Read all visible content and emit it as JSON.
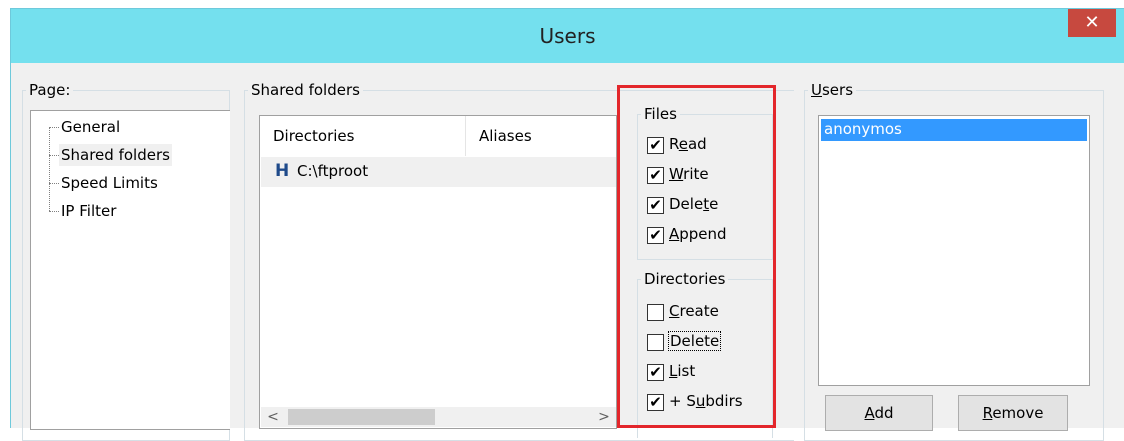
{
  "window": {
    "title": "Users",
    "close_glyph": "✕"
  },
  "page_panel": {
    "label": "Page:",
    "items": [
      "General",
      "Shared folders",
      "Speed Limits",
      "IP Filter"
    ],
    "selected": "Shared folders"
  },
  "shared_folders": {
    "label": "Shared folders",
    "columns": [
      "Directories",
      "Aliases"
    ],
    "rows": [
      {
        "marker": "H",
        "directory": "C:\\ftproot",
        "alias": ""
      }
    ],
    "scroll_left": "<",
    "scroll_right": ">"
  },
  "files": {
    "label": "Files",
    "read": {
      "pre": "R",
      "u": "e",
      "post": "ad",
      "checked": true
    },
    "write": {
      "pre": "",
      "u": "W",
      "post": "rite",
      "checked": true
    },
    "delete": {
      "pre": "Dele",
      "u": "t",
      "post": "e",
      "checked": true
    },
    "append": {
      "pre": "",
      "u": "A",
      "post": "ppend",
      "checked": true
    }
  },
  "directories": {
    "label": "Directories",
    "create": {
      "pre": "",
      "u": "C",
      "post": "reate",
      "checked": false
    },
    "delete": {
      "text": "Delete",
      "checked": false
    },
    "list": {
      "pre": "",
      "u": "L",
      "post": "ist",
      "checked": true
    },
    "subdirs": {
      "pre": "+ S",
      "u": "u",
      "post": "bdirs",
      "checked": true
    }
  },
  "users_panel": {
    "label_u": "U",
    "label_rest": "sers",
    "items": [
      "anonymos"
    ],
    "add_u": "A",
    "add_rest": "dd",
    "remove_u": "R",
    "remove_rest": "emove"
  },
  "icons": {
    "check": "✔"
  },
  "colors": {
    "titlebar": "#74e0ee",
    "close": "#c7493f",
    "highlight_box": "#e3262b",
    "selection": "#3399ff"
  }
}
